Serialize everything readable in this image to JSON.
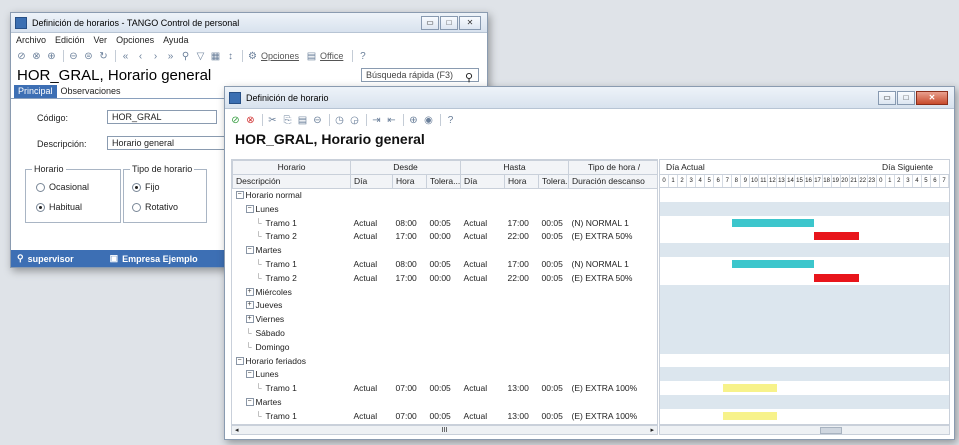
{
  "win1": {
    "title": "Definición de horarios - TANGO Control de personal",
    "menu": [
      "Archivo",
      "Edición",
      "Ver",
      "Opciones",
      "Ayuda"
    ],
    "toolbar_opciones": "Opciones",
    "toolbar_office": "Office",
    "heading": "HOR_GRAL, Horario general",
    "quick_search": "Búsqueda rápida (F3)",
    "tabs": [
      "Principal",
      "Observaciones"
    ],
    "codigo_label": "Código:",
    "codigo_value": "HOR_GRAL",
    "descripcion_label": "Descripción:",
    "descripcion_value": "Horario general",
    "horario_group": "Horario",
    "horario_options": [
      "Ocasional",
      "Habitual"
    ],
    "tipo_group": "Tipo de horario",
    "tipo_options": [
      "Fijo",
      "Rotativo"
    ],
    "status_user": "supervisor",
    "status_company": "Empresa Ejemplo"
  },
  "win2": {
    "title": "Definición de horario",
    "heading": "HOR_GRAL, Horario general",
    "group_headers": [
      "Horario",
      "Desde",
      "Hasta",
      "Tipo de hora /"
    ],
    "columns": [
      "Descripción",
      "Día",
      "Hora",
      "Tolera...",
      "Día",
      "Hora",
      "Tolera...",
      "Duración descanso"
    ],
    "gantt_left": "Día Actual",
    "gantt_right": "Día Siguiente",
    "hours": [
      "0",
      "1",
      "2",
      "3",
      "4",
      "5",
      "6",
      "7",
      "8",
      "9",
      "10",
      "11",
      "12",
      "13",
      "14",
      "15",
      "16",
      "17",
      "18",
      "19",
      "20",
      "21",
      "22",
      "23",
      "0",
      "1",
      "2",
      "3",
      "4",
      "5",
      "6",
      "7"
    ],
    "scroll_mark": "III",
    "colors": {
      "normal": "#3cc6cc",
      "extra50": "#e8151b",
      "extra100": "#f7f28a",
      "band": "#dce6ee"
    },
    "rows": [
      {
        "indent": 0,
        "pm": "-",
        "desc": "Horario normal",
        "cells": [
          "",
          "",
          "",
          "",
          "",
          "",
          ""
        ]
      },
      {
        "indent": 1,
        "pm": "-",
        "desc": "Lunes",
        "cells": [
          "",
          "",
          "",
          "",
          "",
          "",
          ""
        ]
      },
      {
        "indent": 2,
        "pm": "",
        "desc": "Tramo 1",
        "cells": [
          "Actual",
          "08:00",
          "00:05",
          "Actual",
          "17:00",
          "00:05",
          "(N) NORMAL 1"
        ]
      },
      {
        "indent": 2,
        "pm": "",
        "desc": "Tramo 2",
        "cells": [
          "Actual",
          "17:00",
          "00:00",
          "Actual",
          "22:00",
          "00:05",
          "(E) EXTRA 50%"
        ]
      },
      {
        "indent": 1,
        "pm": "-",
        "desc": "Martes",
        "cells": [
          "",
          "",
          "",
          "",
          "",
          "",
          ""
        ]
      },
      {
        "indent": 2,
        "pm": "",
        "desc": "Tramo 1",
        "cells": [
          "Actual",
          "08:00",
          "00:05",
          "Actual",
          "17:00",
          "00:05",
          "(N) NORMAL 1"
        ]
      },
      {
        "indent": 2,
        "pm": "",
        "desc": "Tramo 2",
        "cells": [
          "Actual",
          "17:00",
          "00:00",
          "Actual",
          "22:00",
          "00:05",
          "(E) EXTRA 50%"
        ]
      },
      {
        "indent": 1,
        "pm": "+",
        "desc": "Miércoles",
        "cells": [
          "",
          "",
          "",
          "",
          "",
          "",
          ""
        ]
      },
      {
        "indent": 1,
        "pm": "+",
        "desc": "Jueves",
        "cells": [
          "",
          "",
          "",
          "",
          "",
          "",
          ""
        ]
      },
      {
        "indent": 1,
        "pm": "+",
        "desc": "Viernes",
        "cells": [
          "",
          "",
          "",
          "",
          "",
          "",
          ""
        ]
      },
      {
        "indent": 1,
        "pm": "",
        "desc": "Sábado",
        "cells": [
          "",
          "",
          "",
          "",
          "",
          "",
          ""
        ]
      },
      {
        "indent": 1,
        "pm": "",
        "desc": "Domingo",
        "cells": [
          "",
          "",
          "",
          "",
          "",
          "",
          ""
        ]
      },
      {
        "indent": 0,
        "pm": "-",
        "desc": "Horario feriados",
        "cells": [
          "",
          "",
          "",
          "",
          "",
          "",
          ""
        ]
      },
      {
        "indent": 1,
        "pm": "-",
        "desc": "Lunes",
        "cells": [
          "",
          "",
          "",
          "",
          "",
          "",
          ""
        ]
      },
      {
        "indent": 2,
        "pm": "",
        "desc": "Tramo 1",
        "cells": [
          "Actual",
          "07:00",
          "00:05",
          "Actual",
          "13:00",
          "00:05",
          "(E) EXTRA 100%"
        ]
      },
      {
        "indent": 1,
        "pm": "-",
        "desc": "Martes",
        "cells": [
          "",
          "",
          "",
          "",
          "",
          "",
          ""
        ]
      },
      {
        "indent": 2,
        "pm": "",
        "desc": "Tramo 1",
        "cells": [
          "Actual",
          "07:00",
          "00:05",
          "Actual",
          "13:00",
          "00:05",
          "(E) EXTRA 100%"
        ]
      }
    ],
    "bars": [
      {
        "row": 2,
        "from": 8,
        "to": 17,
        "type": "normal"
      },
      {
        "row": 3,
        "from": 17,
        "to": 22,
        "type": "extra50"
      },
      {
        "row": 5,
        "from": 8,
        "to": 17,
        "type": "normal"
      },
      {
        "row": 6,
        "from": 17,
        "to": 22,
        "type": "extra50"
      },
      {
        "row": 14,
        "from": 7,
        "to": 13,
        "type": "extra100"
      },
      {
        "row": 16,
        "from": 7,
        "to": 13,
        "type": "extra100"
      }
    ],
    "bands": [
      1,
      4,
      7,
      13,
      15
    ]
  }
}
